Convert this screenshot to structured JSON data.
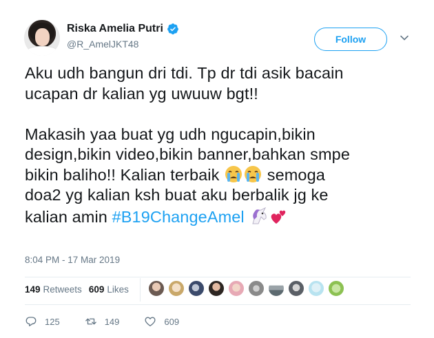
{
  "user": {
    "name": "Riska Amelia Putri",
    "handle": "@R_AmelJKT48",
    "verified": true
  },
  "follow_label": "Follow",
  "tweet": {
    "line1": "Aku udh bangun dri tdi. Tp dr tdi asik bacain",
    "line2": "ucapan dr kalian yg uwuuw bgt!!",
    "line3": "Makasih yaa buat yg udh ngucapin,bikin",
    "line4": "design,bikin video,bikin banner,bahkan smpe",
    "line5_a": "bikin baliho!! Kalian terbaik ",
    "line5_b": " semoga",
    "line6": "doa2 yg kalian ksh buat aku berbalik jg ke",
    "line7_a": "kalian amin ",
    "hashtag": "#B19ChangeAmel"
  },
  "timestamp": "8:04 PM - 17 Mar 2019",
  "stats": {
    "retweets_count": "149",
    "retweets_label": "Retweets",
    "likes_count": "609",
    "likes_label": "Likes"
  },
  "actions": {
    "replies": "125",
    "retweets": "149",
    "likes": "609"
  },
  "icons": [
    "verified-badge-icon",
    "chevron-down-icon",
    "crying-face-emoji",
    "unicorn-emoji",
    "two-hearts-emoji",
    "reply-icon",
    "retweet-icon",
    "heart-icon"
  ],
  "colors": {
    "accent": "#1da1f2",
    "muted": "#657786",
    "text": "#14171a"
  }
}
